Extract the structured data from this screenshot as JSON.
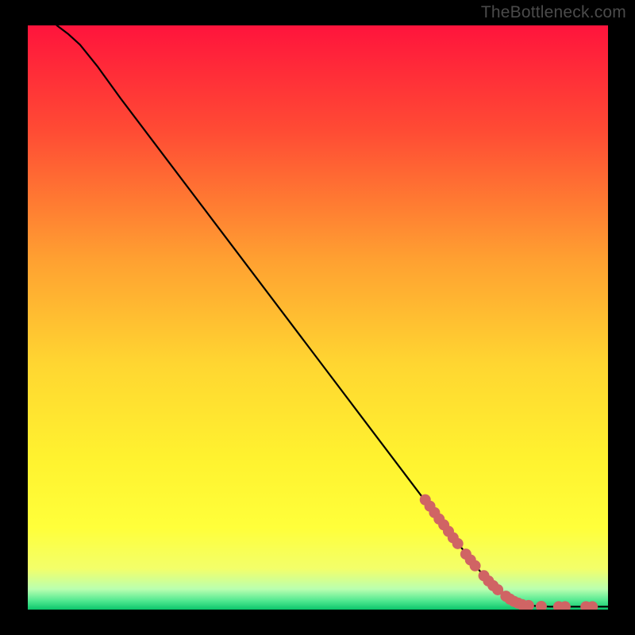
{
  "watermark": "TheBottleneck.com",
  "chart_data": {
    "type": "line",
    "title": "",
    "xlabel": "",
    "ylabel": "",
    "xlim": [
      0,
      100
    ],
    "ylim": [
      0,
      100
    ],
    "gradient_stops": [
      {
        "pos": 0.0,
        "color": "#ff143c"
      },
      {
        "pos": 0.18,
        "color": "#ff4b34"
      },
      {
        "pos": 0.4,
        "color": "#ffa031"
      },
      {
        "pos": 0.58,
        "color": "#ffd631"
      },
      {
        "pos": 0.74,
        "color": "#fff22f"
      },
      {
        "pos": 0.86,
        "color": "#ffff3a"
      },
      {
        "pos": 0.93,
        "color": "#f3ff6a"
      },
      {
        "pos": 0.965,
        "color": "#b9ffb0"
      },
      {
        "pos": 0.985,
        "color": "#50e890"
      },
      {
        "pos": 1.0,
        "color": "#0bc56b"
      }
    ],
    "curve": [
      {
        "x": 5.0,
        "y": 100.0
      },
      {
        "x": 7.0,
        "y": 98.5
      },
      {
        "x": 9.0,
        "y": 96.7
      },
      {
        "x": 12.0,
        "y": 93.0
      },
      {
        "x": 16.0,
        "y": 87.5
      },
      {
        "x": 24.0,
        "y": 77.0
      },
      {
        "x": 32.0,
        "y": 66.5
      },
      {
        "x": 40.0,
        "y": 56.0
      },
      {
        "x": 48.0,
        "y": 45.5
      },
      {
        "x": 56.0,
        "y": 35.0
      },
      {
        "x": 64.0,
        "y": 24.5
      },
      {
        "x": 72.0,
        "y": 14.0
      },
      {
        "x": 78.0,
        "y": 6.5
      },
      {
        "x": 81.0,
        "y": 3.5
      },
      {
        "x": 83.5,
        "y": 1.6
      },
      {
        "x": 86.0,
        "y": 0.7
      },
      {
        "x": 90.0,
        "y": 0.5
      },
      {
        "x": 100.0,
        "y": 0.5
      }
    ],
    "markers": [
      {
        "x": 68.5,
        "y": 18.8
      },
      {
        "x": 69.3,
        "y": 17.7
      },
      {
        "x": 70.1,
        "y": 16.6
      },
      {
        "x": 70.9,
        "y": 15.5
      },
      {
        "x": 71.7,
        "y": 14.5
      },
      {
        "x": 72.5,
        "y": 13.4
      },
      {
        "x": 73.3,
        "y": 12.3
      },
      {
        "x": 74.1,
        "y": 11.3
      },
      {
        "x": 75.5,
        "y": 9.5
      },
      {
        "x": 76.3,
        "y": 8.5
      },
      {
        "x": 77.1,
        "y": 7.5
      },
      {
        "x": 78.6,
        "y": 5.8
      },
      {
        "x": 79.4,
        "y": 4.9
      },
      {
        "x": 80.2,
        "y": 4.1
      },
      {
        "x": 81.0,
        "y": 3.4
      },
      {
        "x": 82.4,
        "y": 2.3
      },
      {
        "x": 83.1,
        "y": 1.8
      },
      {
        "x": 83.8,
        "y": 1.4
      },
      {
        "x": 84.5,
        "y": 1.1
      },
      {
        "x": 85.2,
        "y": 0.85
      },
      {
        "x": 86.3,
        "y": 0.7
      },
      {
        "x": 88.5,
        "y": 0.55
      },
      {
        "x": 91.5,
        "y": 0.5
      },
      {
        "x": 92.6,
        "y": 0.5
      },
      {
        "x": 96.2,
        "y": 0.5
      },
      {
        "x": 97.3,
        "y": 0.5
      }
    ],
    "marker_color": "#d06464",
    "marker_radius_px": 7
  }
}
